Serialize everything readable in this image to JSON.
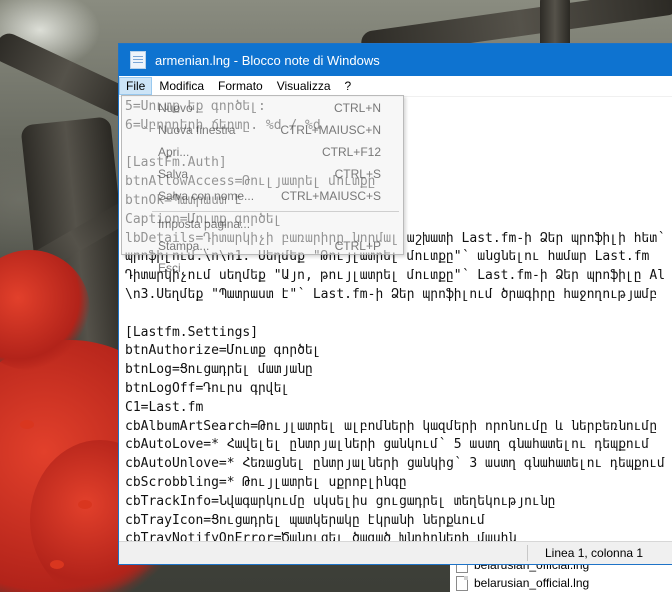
{
  "window": {
    "title": "armenian.lng - Blocco note di Windows"
  },
  "menubar": {
    "items": [
      "File",
      "Modifica",
      "Formato",
      "Visualizza",
      "?"
    ],
    "active": "File"
  },
  "file_menu": {
    "items": [
      {
        "label": "Nuovo",
        "shortcut": "CTRL+N"
      },
      {
        "label": "Nuova finestra",
        "shortcut": "CTRL+MAIUSC+N"
      },
      {
        "label": "Apri...",
        "shortcut": "CTRL+F12"
      },
      {
        "label": "Salva",
        "shortcut": "CTRL+S"
      },
      {
        "label": "Salva con nome...",
        "shortcut": "CTRL+MAIUSC+S"
      },
      {
        "label": "Imposta pagina...",
        "shortcut": ""
      },
      {
        "label": "Stampa...",
        "shortcut": "CTRL+P"
      },
      {
        "label": "Esci",
        "shortcut": ""
      }
    ]
  },
  "editor": {
    "lines": [
      "5=Սուտք եք գործել:",
      "6=Աբորղերի ճերտը. %d / %d",
      "",
      "[LastFm.Auth]",
      "btnAllowAccess=Թուլյատրել մուտքը",
      "btnOk=Պատրաստ է",
      "Caption=Մուտք գործել",
      "lbDetails=Դիտարկիչի բառարիրը նորմալ աշխատի Last.fm-ի Ձեր պրոֆիլի հետ՝",
      "պրոֆիլում.\\n\\n1. Սեղմեք \"Թույլատրել մուտքը\"՝ անցնելու համար Last.fm",
      "Դիտարկիչում սեղմեք \"Այո, թույլատրել մուտքը\"՝ Last.fm-ի Ձեր պրոֆիլը Al",
      "\\n3.Սեղմեք \"Պատրաստ է\"՝ Last.fm-ի Ձեր պրոֆիլում ծրագիրը հաջողությամբ",
      "",
      "[Lastfm.Settings]",
      "btnAuthorize=Մուտք գործել",
      "btnLog=Ցուցադրել մատյանը",
      "btnLogOff=Դուրս գրվել",
      "C1=Last.fm",
      "cbAlbumArtSearch=Թույլատրել ալբոմների կազմերի որոնումը և ներբեռնումը",
      "cbAutoLove=* Հավելել ընտրյալների ցանկում՝ 5 աստղ գնահատելու դեպքում",
      "cbAutoUnlove=* Հեռացնել ընտրյալների ցանկից՝ 3 աստղ գնահատելու դեպքում",
      "cbScrobbling=* Թույլատրել սքրոբլինգը",
      "cbTrackInfo=Նվագարկումը սկսելիս ցուցադրել տեղեկությունը",
      "cbTrayIcon=Ցուցադրել պատկերակը էկրանի ներքևում",
      "cbTrayNotifyOnError=Ծանուցել ծագած խնդիրների մասին",
      "G1=Լրացուցիչներ"
    ]
  },
  "statusbar": {
    "position": "Linea 1, colonna 1"
  },
  "explorer": {
    "files": [
      "belarusian_official.lng",
      "belarusian_official.lng"
    ]
  }
}
